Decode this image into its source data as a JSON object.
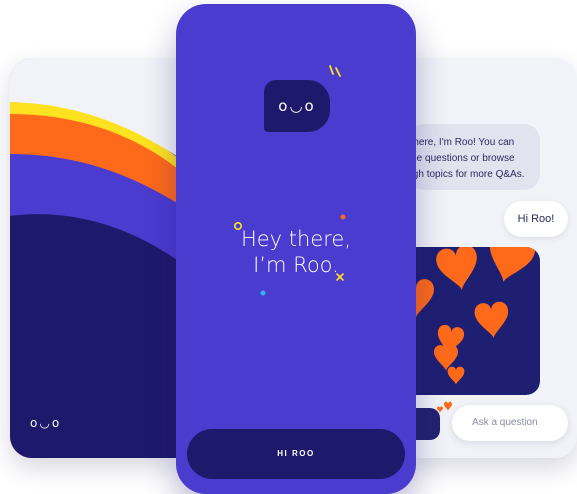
{
  "left_screen": {
    "logo_text": "o◡o"
  },
  "center_screen": {
    "logo_face": "o◡o",
    "headline_line1": "Hey there,",
    "headline_line2": "I’m Roo.",
    "cta_label": "HI ROO"
  },
  "right_screen": {
    "roo_message_line1": "Hey there, I'm Roo! You can",
    "roo_message_line2": "ask me questions or browse",
    "roo_message_line3": "through topics for more Q&As.",
    "user_message": "Hi Roo!",
    "input_placeholder": "Ask a question"
  },
  "colors": {
    "primary_purple": "#4a3ccf",
    "navy": "#1e1a6b",
    "orange": "#ff6a1a",
    "yellow": "#ffe21f"
  }
}
